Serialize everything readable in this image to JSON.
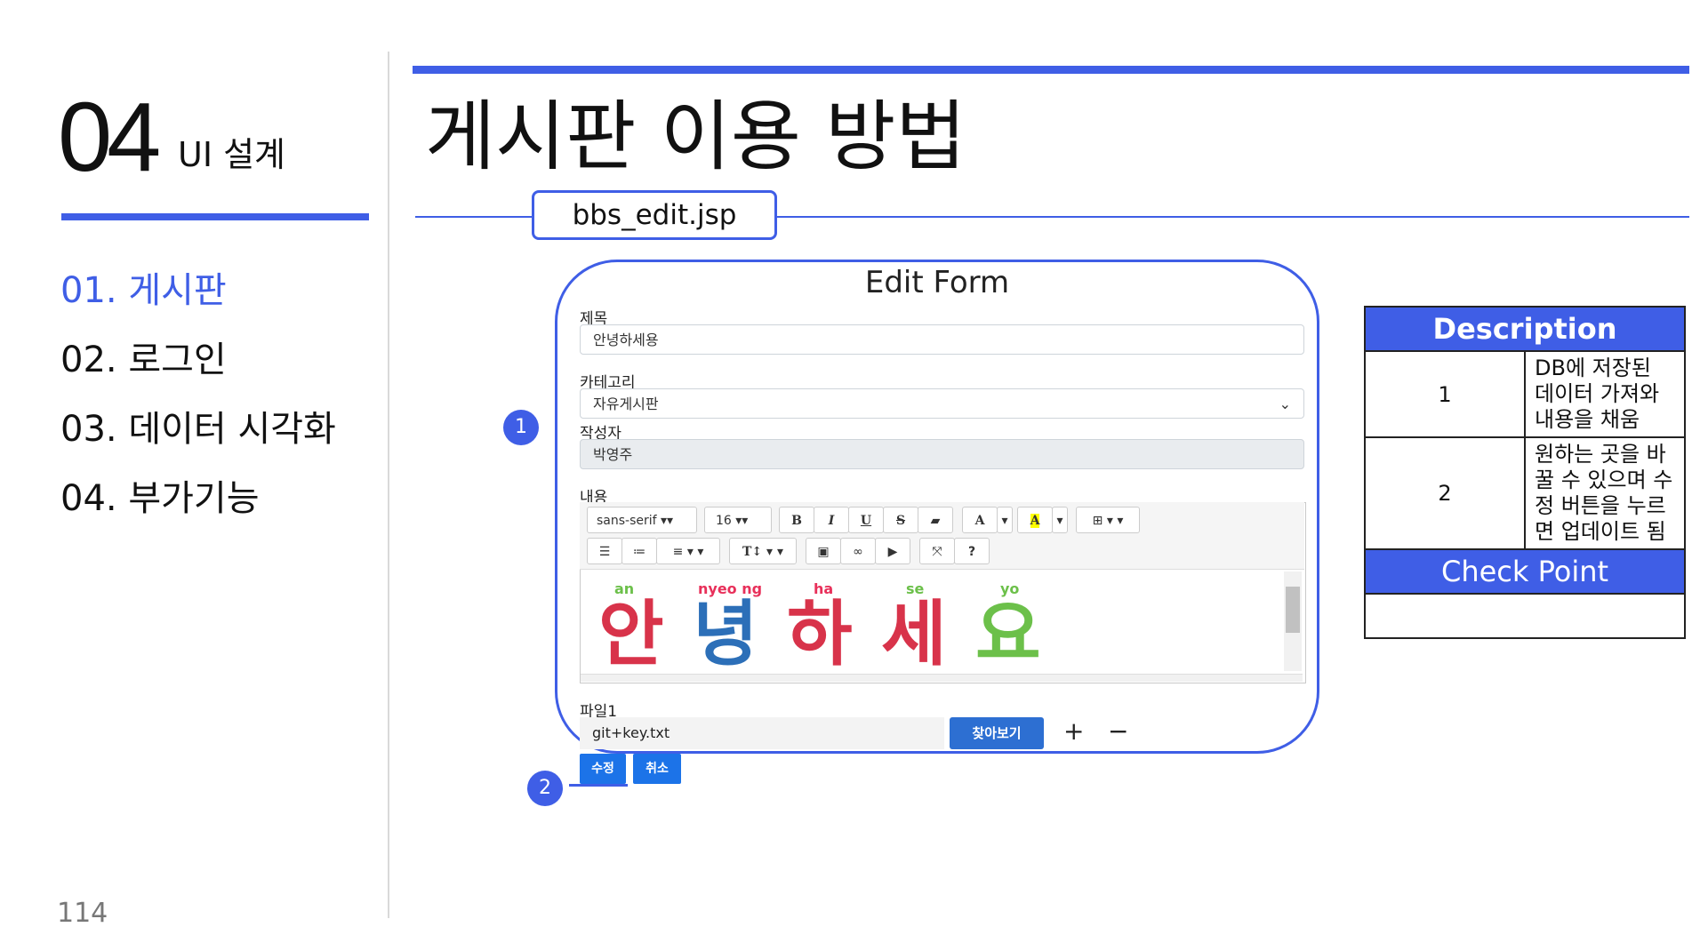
{
  "section": {
    "number": "04",
    "title": "UI 설계"
  },
  "nav": [
    {
      "label": "01. 게시판",
      "active": true
    },
    {
      "label": "02. 로그인",
      "active": false
    },
    {
      "label": "03. 데이터 시각화",
      "active": false
    },
    {
      "label": "04. 부가기능",
      "active": false
    }
  ],
  "page_number": "114",
  "page_title": "게시판 이용 방법",
  "file_tag": "bbs_edit.jsp",
  "form": {
    "title": "Edit Form",
    "subject_label": "제목",
    "subject_value": "안녕하세용",
    "category_label": "카테고리",
    "category_value": "자유게시판",
    "author_label": "작성자",
    "author_value": "박영주",
    "content_label": "내용",
    "toolbar": {
      "font_family": "sans-serif",
      "font_size": "16",
      "bold": "B",
      "italic": "I",
      "underline": "U",
      "strike": "S",
      "color": "A",
      "highlight": "A",
      "text_style": "T",
      "help": "?"
    },
    "content_image": {
      "syllables": [
        "안",
        "녕",
        "하",
        "세",
        "요"
      ],
      "romanization": [
        "an",
        "nyeo ng",
        "ha",
        "se",
        "yo"
      ]
    },
    "file_label": "파일1",
    "file_value": "git+key.txt",
    "browse_label": "찾아보기",
    "add_symbol": "+",
    "remove_symbol": "−",
    "edit_button": "수정",
    "cancel_button": "취소"
  },
  "callouts": [
    "1",
    "2"
  ],
  "description": {
    "header": "Description",
    "rows": [
      {
        "num": "1",
        "text": "DB에 저장된 데이터 가져와 내용을 채움"
      },
      {
        "num": "2",
        "text": "원하는 곳을 바꿀 수 있으며 수정 버튼을 누르면 업데이트 됨"
      }
    ],
    "check_header": "Check Point",
    "check_text": ""
  },
  "colors": {
    "accent": "#3f5ee6",
    "button_blue": "#1c73e8",
    "browse_blue": "#2d6fd2"
  }
}
